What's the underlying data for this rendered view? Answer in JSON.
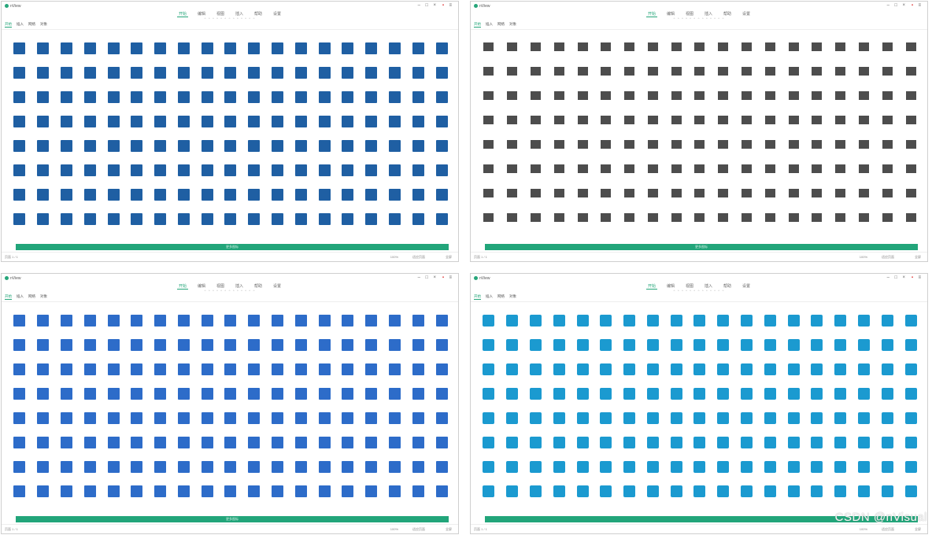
{
  "windows": [
    {
      "app_name": "nView",
      "top_tabs": [
        "开始",
        "编辑",
        "视图",
        "插入",
        "帮助",
        "设置"
      ],
      "selected_top_tab": 0,
      "sub_tabs": [
        "开始",
        "插入",
        "网络",
        "对象"
      ],
      "selected_sub_tab": 0,
      "icon_set": "blue-network-icons",
      "more_button": "更多图标",
      "status_left": "页面 1 / 1",
      "status_right": [
        "100%",
        "适应页面",
        "全屏"
      ]
    },
    {
      "app_name": "nView",
      "top_tabs": [
        "开始",
        "编辑",
        "视图",
        "插入",
        "帮助",
        "设置"
      ],
      "selected_top_tab": 0,
      "sub_tabs": [
        "开始",
        "插入",
        "网络",
        "对象"
      ],
      "selected_sub_tab": 0,
      "icon_set": "grey-device-icons",
      "more_button": "更多图标",
      "status_left": "页面 1 / 1",
      "status_right": [
        "100%",
        "适应页面",
        "全屏"
      ]
    },
    {
      "app_name": "nView",
      "top_tabs": [
        "开始",
        "编辑",
        "视图",
        "插入",
        "帮助",
        "设置"
      ],
      "selected_top_tab": 0,
      "sub_tabs": [
        "开始",
        "插入",
        "网络",
        "对象"
      ],
      "selected_sub_tab": 0,
      "icon_set": "blue-isometric-icons",
      "more_button": "更多图标",
      "status_left": "页面 1 / 1",
      "status_right": [
        "100%",
        "适应页面",
        "全屏"
      ]
    },
    {
      "app_name": "nView",
      "top_tabs": [
        "开始",
        "编辑",
        "视图",
        "插入",
        "帮助",
        "设置"
      ],
      "selected_top_tab": 0,
      "sub_tabs": [
        "开始",
        "插入",
        "网络",
        "对象"
      ],
      "selected_sub_tab": 0,
      "icon_set": "cisco-style-icons",
      "more_button": "",
      "status_left": "页面 1 / 1",
      "status_right": [
        "100%",
        "适应页面",
        "全屏"
      ]
    }
  ],
  "watermark": "CSDN @nVisual",
  "colors": {
    "accent": "#22a57a",
    "icon_blue": "#1f5fa3",
    "iso_blue": "#2d6cc9",
    "cisco_blue": "#1b9ad0",
    "device_grey": "#4d4d4d"
  }
}
